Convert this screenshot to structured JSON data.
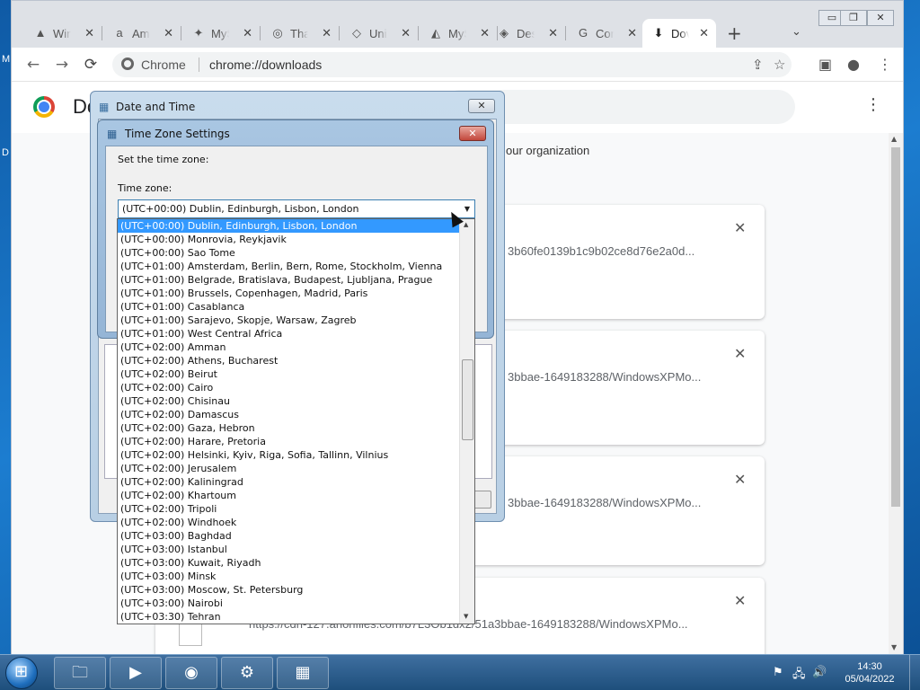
{
  "desktop": {
    "edge_texts": [
      "M",
      "D"
    ]
  },
  "browser": {
    "tabs": [
      {
        "label": "Win",
        "icon": "WIN",
        "glyph": "▲"
      },
      {
        "label": "Am",
        "icon": "AMAZON",
        "glyph": "a"
      },
      {
        "label": "MyS",
        "icon": "MYSTIC",
        "glyph": "✦"
      },
      {
        "label": "Tha",
        "icon": "GLOBE",
        "glyph": "◎"
      },
      {
        "label": "Univ",
        "icon": "UNIV",
        "glyph": "◇"
      },
      {
        "label": "MyS",
        "icon": "MYSTIC2",
        "glyph": "◭"
      },
      {
        "label": "Des",
        "icon": "DES",
        "glyph": "◈"
      },
      {
        "label": "Con",
        "icon": "GOOGLE",
        "glyph": "G"
      },
      {
        "label": "Dov",
        "icon": "DOWNLOAD",
        "glyph": "⬇"
      }
    ],
    "close_glyph": "✕",
    "new_tab_glyph": "+",
    "tab_menu_glyph": "⌄",
    "window_controls": {
      "minimize": "▭",
      "restore": "❐",
      "close": "✕"
    },
    "nav": {
      "back": "←",
      "forward": "→",
      "reload": "⟳"
    },
    "omnibox": {
      "chip": "Chrome",
      "url": "chrome://downloads"
    },
    "toolbar_icons": {
      "share": "⇪",
      "star": "☆",
      "sidepanel": "▣",
      "profile": "●",
      "menu": "⋮"
    }
  },
  "downloads": {
    "title": "Do",
    "managed_text": "our organization",
    "cards": [
      {
        "url": "3b60fe0139b1c9b02ce8d76e2a0d..."
      },
      {
        "url": "3bbae-1649183288/WindowsXPMo..."
      },
      {
        "url": "3bbae-1649183288/WindowsXPMo..."
      },
      {
        "url": "https://cdn-127.anonfiles.com/b7L3Ob1dx2/51a3bbae-1649183288/WindowsXPMo..."
      }
    ],
    "remove_glyph": "✕",
    "kebab": "⋮"
  },
  "date_time_dialog": {
    "title": "Date and Time",
    "close": "✕"
  },
  "timezone_dialog": {
    "title": "Time Zone Settings",
    "close": "✕",
    "prompt": "Set the time zone:",
    "label": "Time zone:",
    "selected": "(UTC+00:00) Dublin, Edinburgh, Lisbon, London",
    "arrow": "▼"
  },
  "timezone_options": [
    "(UTC+00:00) Dublin, Edinburgh, Lisbon, London",
    "(UTC+00:00) Monrovia, Reykjavik",
    "(UTC+00:00) Sao Tome",
    "(UTC+01:00) Amsterdam, Berlin, Bern, Rome, Stockholm, Vienna",
    "(UTC+01:00) Belgrade, Bratislava, Budapest, Ljubljana, Prague",
    "(UTC+01:00) Brussels, Copenhagen, Madrid, Paris",
    "(UTC+01:00) Casablanca",
    "(UTC+01:00) Sarajevo, Skopje, Warsaw, Zagreb",
    "(UTC+01:00) West Central Africa",
    "(UTC+02:00) Amman",
    "(UTC+02:00) Athens, Bucharest",
    "(UTC+02:00) Beirut",
    "(UTC+02:00) Cairo",
    "(UTC+02:00) Chisinau",
    "(UTC+02:00) Damascus",
    "(UTC+02:00) Gaza, Hebron",
    "(UTC+02:00) Harare, Pretoria",
    "(UTC+02:00) Helsinki, Kyiv, Riga, Sofia, Tallinn, Vilnius",
    "(UTC+02:00) Jerusalem",
    "(UTC+02:00) Kaliningrad",
    "(UTC+02:00) Khartoum",
    "(UTC+02:00) Tripoli",
    "(UTC+02:00) Windhoek",
    "(UTC+03:00) Baghdad",
    "(UTC+03:00) Istanbul",
    "(UTC+03:00) Kuwait, Riyadh",
    "(UTC+03:00) Minsk",
    "(UTC+03:00) Moscow, St. Petersburg",
    "(UTC+03:00) Nairobi",
    "(UTC+03:30) Tehran"
  ],
  "selected_option_index": 0,
  "taskbar": {
    "apps": [
      {
        "name": "explorer",
        "glyph": "🗀"
      },
      {
        "name": "media-player",
        "glyph": "▶"
      },
      {
        "name": "chrome",
        "glyph": "◉"
      },
      {
        "name": "control-panel",
        "glyph": "⚙"
      },
      {
        "name": "date-time",
        "glyph": "▦"
      }
    ],
    "tray": {
      "flag": "⚑",
      "network": "🖧",
      "volume": "🔊"
    },
    "clock": {
      "time": "14:30",
      "date": "05/04/2022"
    }
  },
  "colors": {
    "selection": "#3399ff",
    "taskbar": "#1e4f7c",
    "tz_close": "#c2473b"
  }
}
